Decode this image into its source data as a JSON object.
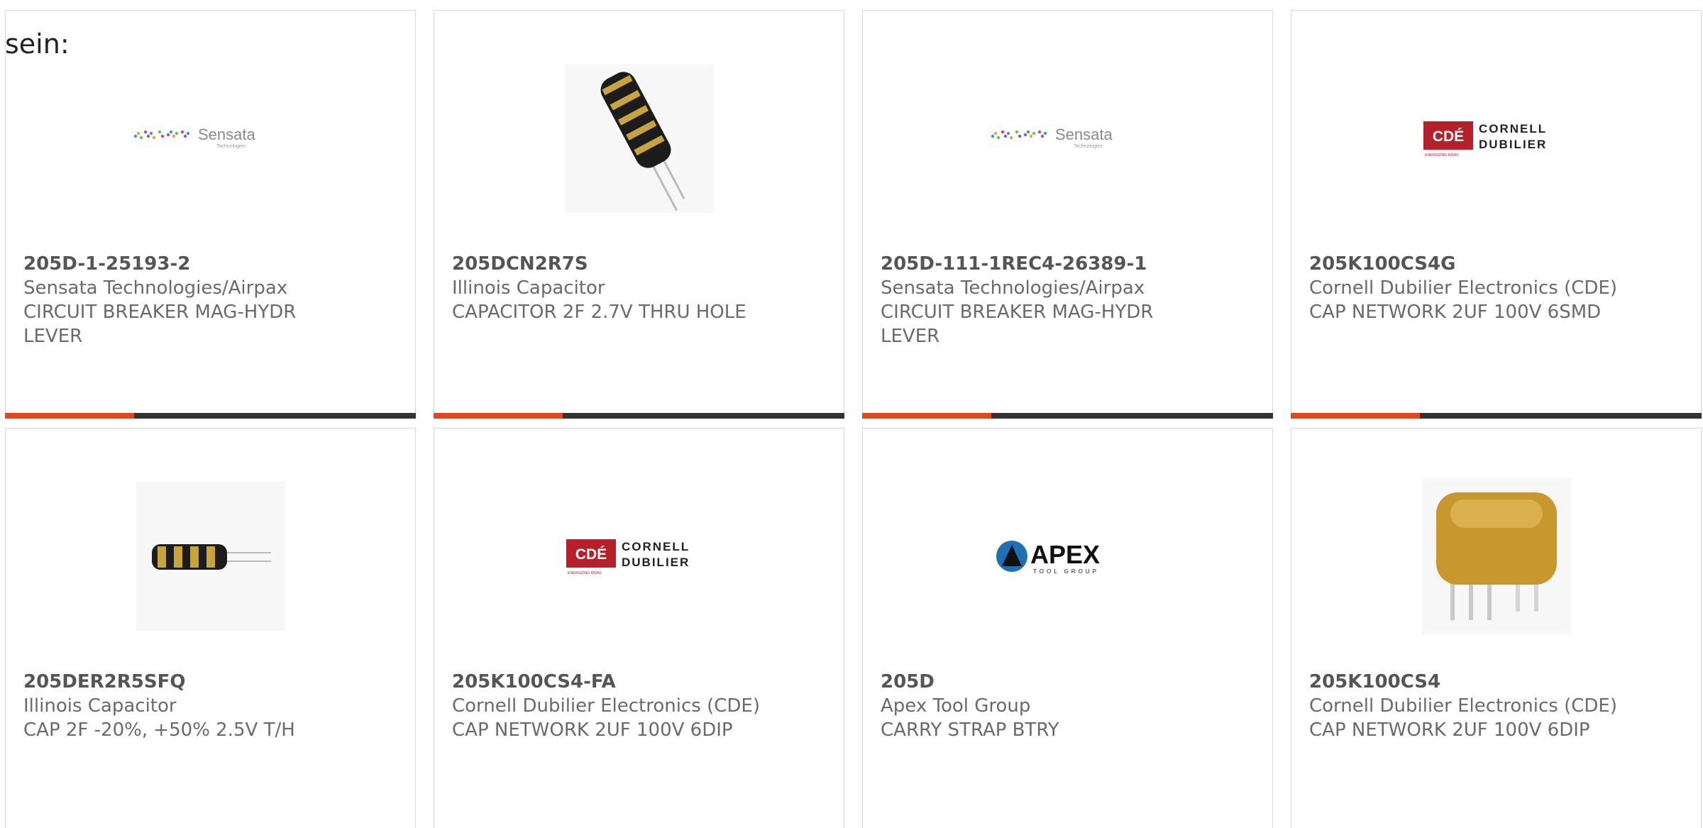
{
  "intro_text": "sein:",
  "colors": {
    "accent": "#e8441a",
    "bar_dark": "#333333",
    "card_border": "#d6d6d6",
    "cde_red": "#b5202a",
    "apex_blue": "#1f6fb5",
    "sensata_dots": [
      "#4a8fd0",
      "#e6a92b",
      "#6bbf59",
      "#d2457b",
      "#8a5bc4"
    ]
  },
  "cards": [
    {
      "part_number": "205D-1-25193-2",
      "manufacturer": "Sensata Technologies/Airpax",
      "desc_lines": [
        "CIRCUIT BREAKER MAG-HYDR",
        "LEVER"
      ],
      "image": "sensata-logo",
      "logo_text": "Sensata",
      "logo_subtext": "Technologies"
    },
    {
      "part_number": "205DCN2R7S",
      "manufacturer": "Illinois Capacitor",
      "desc_lines": [
        "CAPACITOR 2F 2.7V THRU HOLE"
      ],
      "image": "capacitor-photo-large"
    },
    {
      "part_number": "205D-111-1REC4-26389-1",
      "manufacturer": "Sensata Technologies/Airpax",
      "desc_lines": [
        "CIRCUIT BREAKER MAG-HYDR",
        "LEVER"
      ],
      "image": "sensata-logo",
      "logo_text": "Sensata",
      "logo_subtext": "Technologies"
    },
    {
      "part_number": "205K100CS4G",
      "manufacturer": "Cornell Dubilier Electronics (CDE)",
      "desc_lines": [
        "CAP NETWORK 2UF 100V 6SMD"
      ],
      "image": "cde-logo",
      "logo_mark": "CDÉ",
      "logo_line1": "CORNELL",
      "logo_line2": "DUBILIER",
      "logo_tagline": "ENERGIZING IDEAS"
    },
    {
      "part_number": "205DER2R5SFQ",
      "manufacturer": "Illinois Capacitor",
      "desc_lines": [
        "CAP 2F -20%, +50% 2.5V T/H"
      ],
      "image": "capacitor-photo-small"
    },
    {
      "part_number": "205K100CS4-FA",
      "manufacturer": "Cornell Dubilier Electronics (CDE)",
      "desc_lines": [
        "CAP NETWORK 2UF 100V 6DIP"
      ],
      "image": "cde-logo",
      "logo_mark": "CDÉ",
      "logo_line1": "CORNELL",
      "logo_line2": "DUBILIER",
      "logo_tagline": "ENERGIZING IDEAS"
    },
    {
      "part_number": "205D",
      "manufacturer": "Apex Tool Group",
      "desc_lines": [
        "CARRY STRAP BTRY"
      ],
      "image": "apex-logo",
      "logo_text": "APEX",
      "logo_subtext": "TOOL GROUP"
    },
    {
      "part_number": "205K100CS4",
      "manufacturer": "Cornell Dubilier Electronics (CDE)",
      "desc_lines": [
        "CAP NETWORK 2UF 100V 6DIP"
      ],
      "image": "cap-network-photo"
    }
  ]
}
